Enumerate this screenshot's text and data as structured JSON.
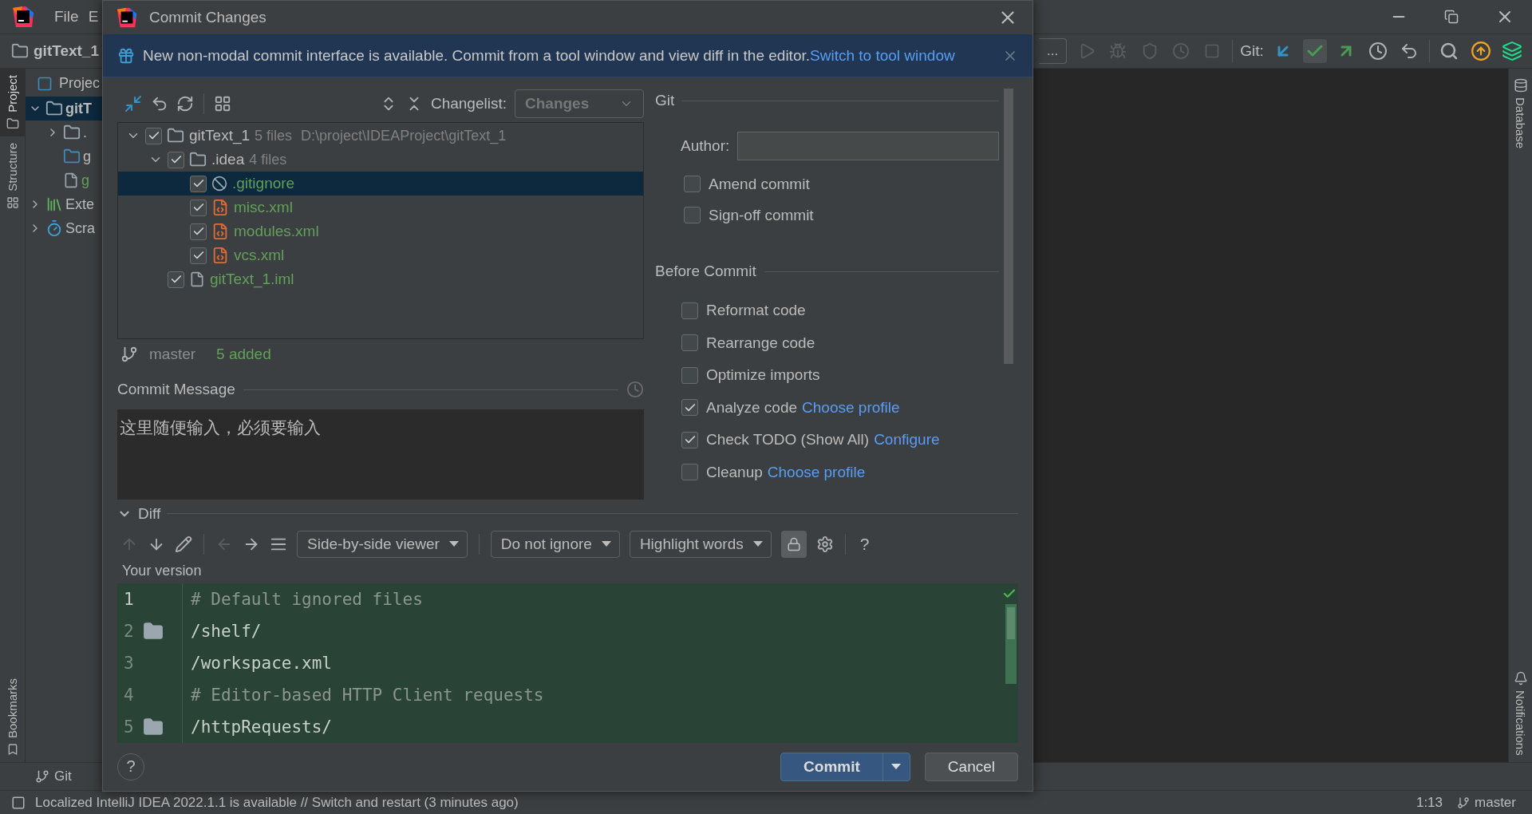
{
  "ide": {
    "menu": [
      "File",
      "E"
    ],
    "breadcrumb": "gitText_1",
    "run_config": "...",
    "git_label": "Git:",
    "left_tools": [
      {
        "label": "Project",
        "selected": true
      },
      {
        "label": "Structure",
        "selected": false
      }
    ],
    "left_tools_bottom": [
      {
        "label": "Bookmarks",
        "selected": false
      }
    ],
    "project_header": "Projec",
    "project_tree": [
      {
        "label": "gitT",
        "kind": "module",
        "expanded": true,
        "selected": true,
        "children": [
          {
            "label": ".",
            "kind": "folder",
            "expanded": false,
            "selected": false
          },
          {
            "label": "g",
            "kind": "source_folder",
            "selected": false
          },
          {
            "label": "g",
            "kind": "iml",
            "selected": false
          }
        ]
      },
      {
        "label": "Exte",
        "kind": "library",
        "expanded": false,
        "selected": false
      },
      {
        "label": "Scra",
        "kind": "scratch",
        "expanded": false,
        "selected": false
      }
    ],
    "right_tools": [
      {
        "label": "Database",
        "kind": "database"
      },
      {
        "label": "Notifications",
        "kind": "notifications"
      }
    ],
    "bottom_tabs": [
      "Git"
    ],
    "status": {
      "message": "Localized IntelliJ IDEA 2022.1.1 is available // Switch and restart (3 minutes ago)",
      "position": "1:13",
      "branch": "master"
    }
  },
  "dialog": {
    "title": "Commit Changes",
    "banner": {
      "text": "New non-modal commit interface is available. Commit from a tool window and view diff in the editor.",
      "link": "Switch to tool window"
    },
    "changelist": {
      "label": "Changelist:",
      "value": "Changes"
    },
    "changes": [
      {
        "name": "gitText_1",
        "kind": "module",
        "detail": "5 files",
        "path": "D:\\project\\IDEAProject\\gitText_1",
        "checked": true,
        "expanded": true,
        "selected": false,
        "children": [
          {
            "name": ".idea",
            "kind": "folder",
            "detail": "4 files",
            "checked": true,
            "expanded": true,
            "selected": false,
            "children": [
              {
                "name": ".gitignore",
                "kind": "ignore",
                "checked": true,
                "selected": true
              },
              {
                "name": "misc.xml",
                "kind": "xml",
                "checked": true,
                "selected": false
              },
              {
                "name": "modules.xml",
                "kind": "xml",
                "checked": true,
                "selected": false
              },
              {
                "name": "vcs.xml",
                "kind": "xml",
                "checked": true,
                "selected": false
              }
            ]
          },
          {
            "name": "gitText_1.iml",
            "kind": "iml",
            "checked": true,
            "selected": false
          }
        ]
      }
    ],
    "branch": "master",
    "summary": "5 added",
    "commit_message": {
      "label": "Commit Message",
      "value": "这里随便输入，必须要输入"
    },
    "git": {
      "title": "Git",
      "author_label": "Author:",
      "options": [
        {
          "label": "Amend commit",
          "checked": false
        },
        {
          "label": "Sign-off commit",
          "checked": false
        }
      ]
    },
    "before_commit": {
      "title": "Before Commit",
      "options": [
        {
          "label": "Reformat code",
          "checked": false
        },
        {
          "label": "Rearrange code",
          "checked": false
        },
        {
          "label": "Optimize imports",
          "checked": false
        },
        {
          "label": "Analyze code",
          "checked": true,
          "link": "Choose profile"
        },
        {
          "label": "Check TODO (Show All)",
          "checked": true,
          "link": "Configure"
        },
        {
          "label": "Cleanup",
          "checked": false,
          "link": "Choose profile"
        }
      ]
    },
    "diff": {
      "title": "Diff",
      "expanded": true,
      "viewer": "Side-by-side viewer",
      "ignore": "Do not ignore",
      "highlight": "Highlight words",
      "locked": true,
      "help": "?",
      "side_label": "Your version",
      "lines": [
        {
          "number": "1",
          "text": "# Default ignored files",
          "kind": "comment",
          "current": true,
          "folder_marker": false
        },
        {
          "number": "2",
          "text": "/shelf/",
          "kind": "code",
          "current": false,
          "folder_marker": true
        },
        {
          "number": "3",
          "text": "/workspace.xml",
          "kind": "code",
          "current": false,
          "folder_marker": false
        },
        {
          "number": "4",
          "text": "# Editor-based HTTP Client requests",
          "kind": "comment",
          "current": false,
          "folder_marker": false
        },
        {
          "number": "5",
          "text": "/httpRequests/",
          "kind": "code",
          "current": false,
          "folder_marker": true
        }
      ]
    },
    "buttons": [
      {
        "label": "Commit",
        "kind": "primary"
      },
      {
        "label": "Cancel",
        "kind": "secondary"
      }
    ]
  }
}
